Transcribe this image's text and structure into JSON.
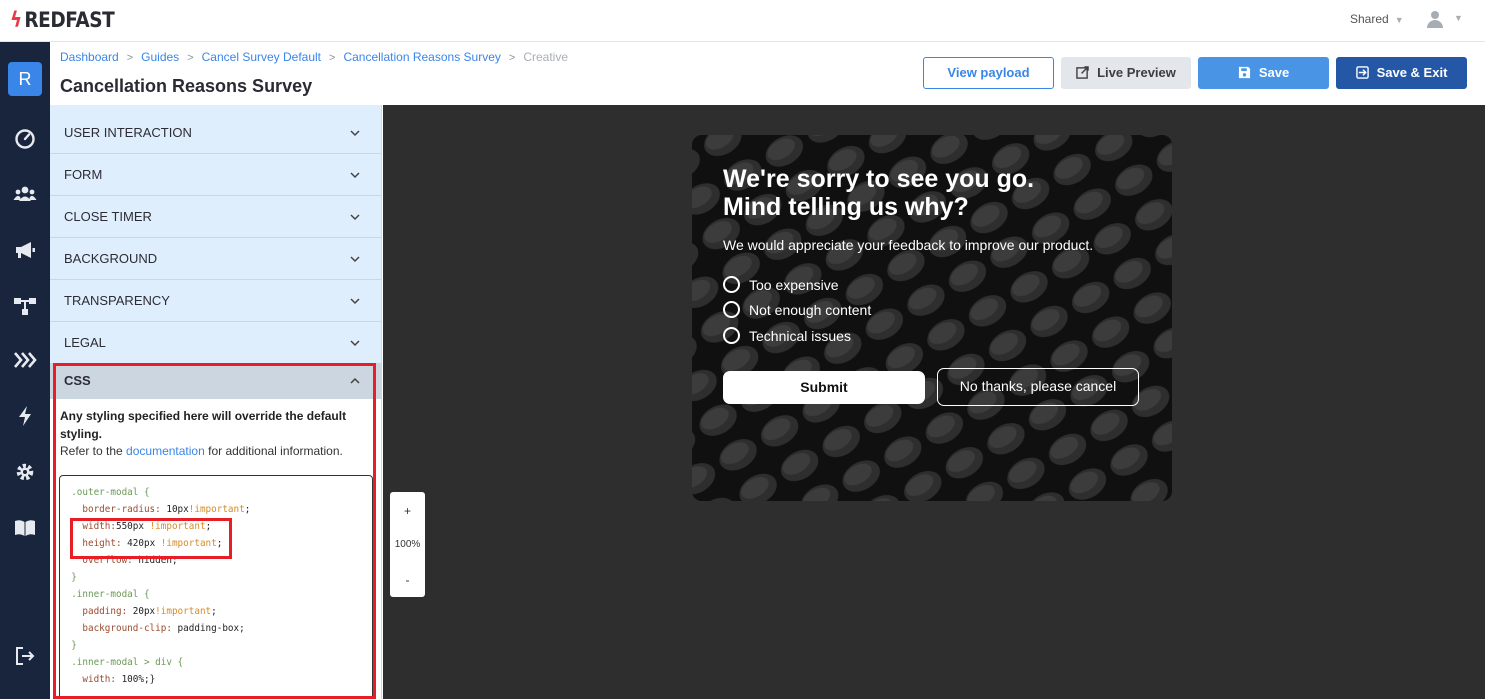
{
  "topbar": {
    "logo": "REDFAST",
    "shared": "Shared"
  },
  "nav": {
    "badge": "R",
    "icons": [
      "dashboard-icon",
      "users-icon",
      "megaphone-icon",
      "flow-icon",
      "chevrons-icon",
      "bolt-icon",
      "gear-icon",
      "book-icon",
      "logout-icon"
    ]
  },
  "header": {
    "breadcrumbs": [
      "Dashboard",
      "Guides",
      "Cancel Survey Default",
      "Cancellation Reasons Survey",
      "Creative"
    ],
    "title": "Cancellation Reasons Survey",
    "view_payload": "View payload",
    "live_preview": "Live Preview",
    "save": "Save",
    "save_exit": "Save & Exit"
  },
  "panel": {
    "sections": [
      "USER INTERACTION",
      "FORM",
      "CLOSE TIMER",
      "BACKGROUND",
      "TRANSPARENCY",
      "LEGAL"
    ],
    "css_title": "CSS",
    "css_desc": "Any styling specified here will override the default styling.",
    "ref_prefix": "Refer to the",
    "ref_link": "documentation",
    "ref_suffix": "for additional information.",
    "code_lines": [
      ".outer-modal {",
      "  border-radius: 10px!important;",
      "  width:550px !important;",
      "  height: 420px !important;",
      "  overflow: hidden;",
      "}",
      ".inner-modal {",
      "  padding: 20px!important;",
      "  background-clip: padding-box;",
      "}",
      ".inner-modal > div {",
      "  width: 100%;}"
    ]
  },
  "preview": {
    "title_line1": "We're sorry to see you go.",
    "title_line2": "Mind telling us why?",
    "subtitle": "We would appreciate your feedback to improve our product.",
    "options": [
      "Too expensive",
      "Not enough content",
      "Technical issues"
    ],
    "submit": "Submit",
    "cancel": "No thanks, please cancel"
  },
  "zoom": {
    "plus": "+",
    "level": "100%",
    "minus": "-"
  },
  "colors": {
    "accent": "#3a86e8",
    "nav_bg": "#19253d",
    "highlight": "#e81e26"
  }
}
